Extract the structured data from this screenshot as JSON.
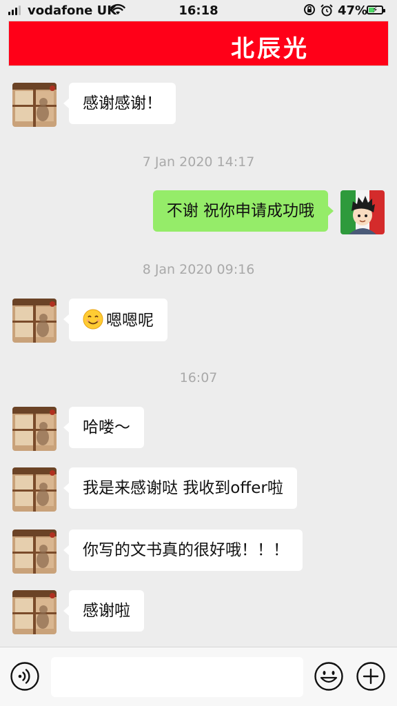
{
  "status_bar": {
    "carrier": "vodafone UK",
    "time": "16:18",
    "battery_percent": "47%",
    "battery_level": 0.47,
    "icons": [
      "signal-icon",
      "wifi-icon",
      "rotation-lock-icon",
      "alarm-icon",
      "battery-charging-icon"
    ]
  },
  "header": {
    "title": "北辰光",
    "background_color": "#ff0018"
  },
  "messages": [
    {
      "type": "incoming",
      "text": "感谢感谢！"
    },
    {
      "type": "timestamp",
      "text": "7 Jan 2020 14:17"
    },
    {
      "type": "outgoing",
      "text": "不谢 祝你申请成功哦"
    },
    {
      "type": "timestamp",
      "text": "8 Jan 2020 09:16"
    },
    {
      "type": "incoming",
      "emoji": "smile-emoji",
      "text": "嗯嗯呢"
    },
    {
      "type": "timestamp",
      "text": "16:07"
    },
    {
      "type": "incoming",
      "text": "哈喽～"
    },
    {
      "type": "incoming",
      "text": "我是来感谢哒 我收到offer啦"
    },
    {
      "type": "incoming",
      "text": "你写的文书真的很好哦！！！"
    },
    {
      "type": "incoming",
      "text": "感谢啦"
    }
  ],
  "input_bar": {
    "voice_icon": "voice-icon",
    "emoji_icon": "emoji-icon",
    "plus_icon": "plus-icon",
    "text_value": ""
  },
  "colors": {
    "background": "#ededed",
    "incoming_bubble": "#ffffff",
    "outgoing_bubble": "#95ec69",
    "timestamp_text": "#a9a9a9"
  }
}
